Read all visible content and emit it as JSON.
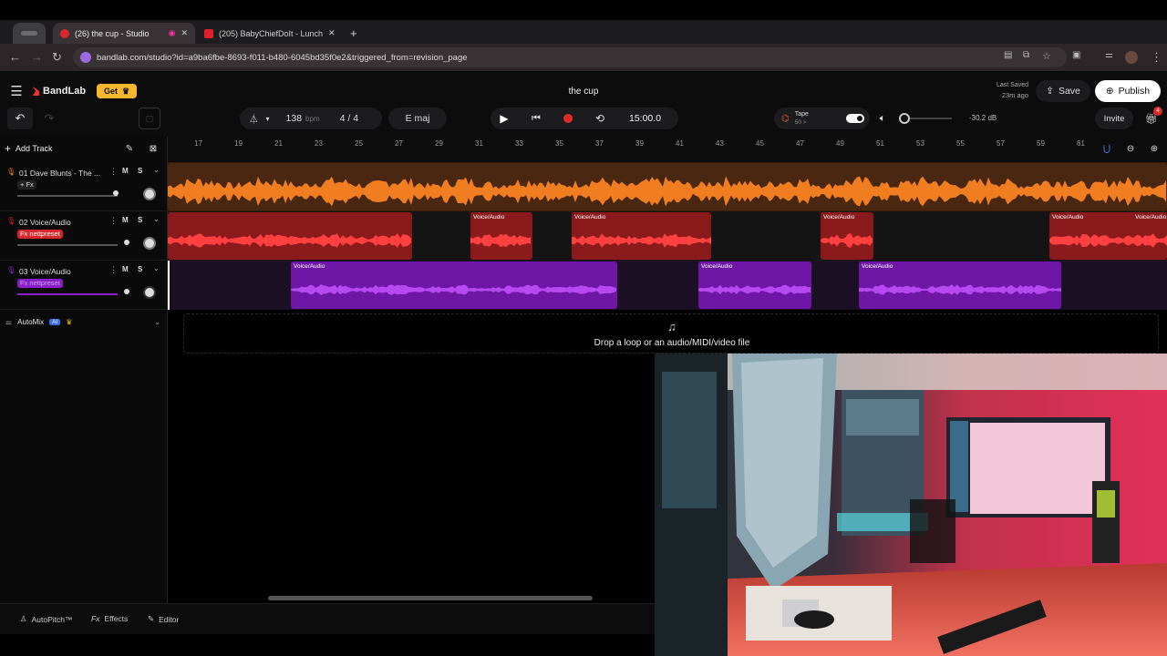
{
  "browser": {
    "tabs": [
      {
        "label": "(26) the cup - Studio",
        "active": true
      },
      {
        "label": "(205) BabyChiefDoIt - Lunch",
        "active": false
      }
    ],
    "new_tab": "+",
    "url": "bandlab.com/studio?id=a9ba6fbe-8693-f011-b480-6045bd35f0e2&triggered_from=revision_page"
  },
  "header": {
    "brand": "BandLab",
    "get_label": "Get",
    "project_title": "the cup",
    "last_saved_line1": "Last Saved",
    "last_saved_line2": "23m ago",
    "save_label": "Save",
    "publish_label": "Publish",
    "invite_label": "Invite",
    "notif_count": "4"
  },
  "transport": {
    "bpm": "138",
    "bpm_unit": "bpm",
    "time_sig": "4 / 4",
    "key": "E maj",
    "time": "15:00.0",
    "tape_label": "Tape",
    "tape_value": "50 >",
    "volume_db": "-30.2 dB"
  },
  "tracks_panel": {
    "add_track": "Add Track",
    "automix": "AutoMix",
    "ai_badge": "AI",
    "tracks": [
      {
        "label": "01  Dave Blunts - The ...",
        "fx": "+ Fx",
        "color": "#f07d1f"
      },
      {
        "label": "02  Voice/Audio",
        "fx": "Fx nettpreset",
        "color": "#d8262a"
      },
      {
        "label": "03  Voice/Audio",
        "fx": "Fx  nettpreset",
        "color": "#8a1fc9"
      }
    ],
    "m": "M",
    "s": "S"
  },
  "ruler": {
    "ticks": [
      "17",
      "19",
      "21",
      "23",
      "25",
      "27",
      "29",
      "31",
      "33",
      "35",
      "37",
      "39",
      "41",
      "43",
      "45",
      "47",
      "49",
      "51",
      "53",
      "55",
      "57",
      "59",
      "61"
    ]
  },
  "clips": {
    "label": "Voice/Audio"
  },
  "dropzone": {
    "text": "Drop a loop or an audio/MIDI/video file"
  },
  "bottom": {
    "autopitch": "AutoPitch™",
    "effects": "Effects",
    "editor": "Editor"
  },
  "colors": {
    "orange": "#f07d1f",
    "red": "#d8262a",
    "purple": "#8a1fc9",
    "accent_yellow": "#f5b82e"
  }
}
